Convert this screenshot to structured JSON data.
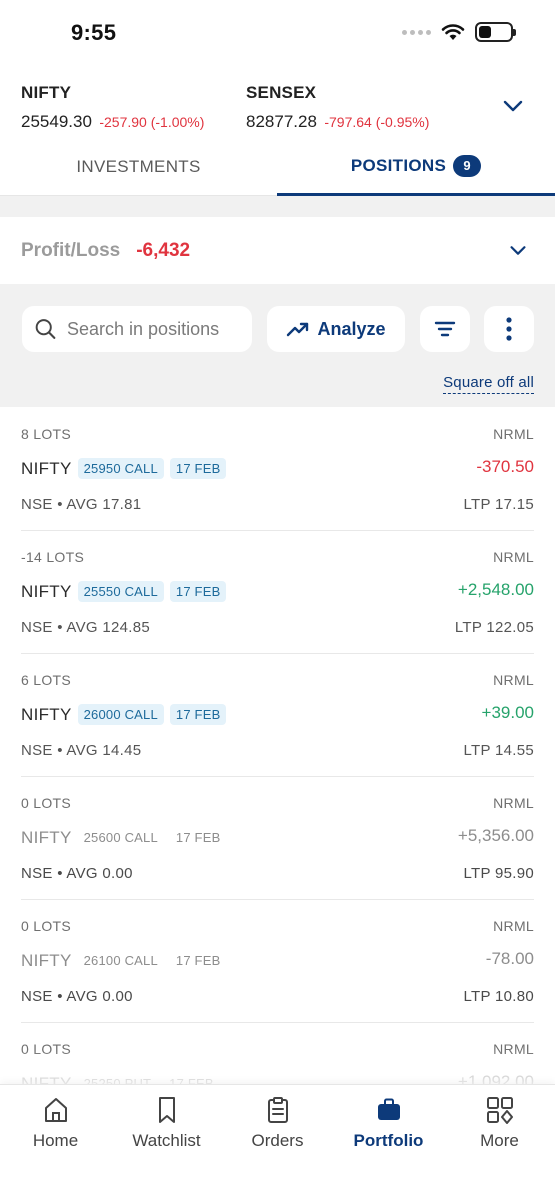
{
  "status_bar": {
    "time": "9:55"
  },
  "indices": [
    {
      "name": "NIFTY",
      "price": "25549.30",
      "change": "-257.90 (-1.00%)"
    },
    {
      "name": "SENSEX",
      "price": "82877.28",
      "change": "-797.64 (-0.95%)"
    }
  ],
  "tabs": {
    "investments": "INVESTMENTS",
    "positions": "POSITIONS",
    "positions_count": "9"
  },
  "summary": {
    "label": "Profit/Loss",
    "value": "-6,432"
  },
  "toolbar": {
    "search_placeholder": "Search in positions",
    "analyze_label": "Analyze",
    "square_off_label": "Square off all"
  },
  "positions": [
    {
      "lots": "8 LOTS",
      "product": "NRML",
      "symbol": "NIFTY",
      "strike": "25950 CALL",
      "expiry": "17 FEB",
      "pnl": "-370.50",
      "pnl_color": "#e0343f",
      "exch_avg": "NSE • AVG 17.81",
      "ltp": "LTP 17.15",
      "open": true
    },
    {
      "lots": "-14 LOTS",
      "product": "NRML",
      "symbol": "NIFTY",
      "strike": "25550 CALL",
      "expiry": "17 FEB",
      "pnl": "+2,548.00",
      "pnl_color": "#26a36b",
      "exch_avg": "NSE • AVG 124.85",
      "ltp": "LTP 122.05",
      "open": true
    },
    {
      "lots": "6 LOTS",
      "product": "NRML",
      "symbol": "NIFTY",
      "strike": "26000 CALL",
      "expiry": "17 FEB",
      "pnl": "+39.00",
      "pnl_color": "#26a36b",
      "exch_avg": "NSE • AVG 14.45",
      "ltp": "LTP 14.55",
      "open": true
    },
    {
      "lots": "0 LOTS",
      "product": "NRML",
      "symbol": "NIFTY",
      "strike": "25600 CALL",
      "expiry": "17 FEB",
      "pnl": "+5,356.00",
      "pnl_color": "#8d8d8d",
      "exch_avg": "NSE • AVG 0.00",
      "ltp": "LTP 95.90",
      "open": false
    },
    {
      "lots": "0 LOTS",
      "product": "NRML",
      "symbol": "NIFTY",
      "strike": "26100 CALL",
      "expiry": "17 FEB",
      "pnl": "-78.00",
      "pnl_color": "#8d8d8d",
      "exch_avg": "NSE • AVG 0.00",
      "ltp": "LTP 10.80",
      "open": false
    },
    {
      "lots": "0 LOTS",
      "product": "NRML",
      "symbol": "NIFTY",
      "strike": "25250 PUT",
      "expiry": "17 FEB",
      "pnl": "+1,092.00",
      "pnl_color": "#8d8d8d",
      "exch_avg": "",
      "ltp": "",
      "open": false
    }
  ],
  "bottom_nav": [
    {
      "label": "Home",
      "icon": "home-icon"
    },
    {
      "label": "Watchlist",
      "icon": "bookmark-icon"
    },
    {
      "label": "Orders",
      "icon": "clipboard-icon"
    },
    {
      "label": "Portfolio",
      "icon": "briefcase-icon"
    },
    {
      "label": "More",
      "icon": "grid-icon"
    }
  ],
  "colors": {
    "brand": "#0d3a7a",
    "loss": "#e0343f",
    "gain": "#26a36b"
  }
}
